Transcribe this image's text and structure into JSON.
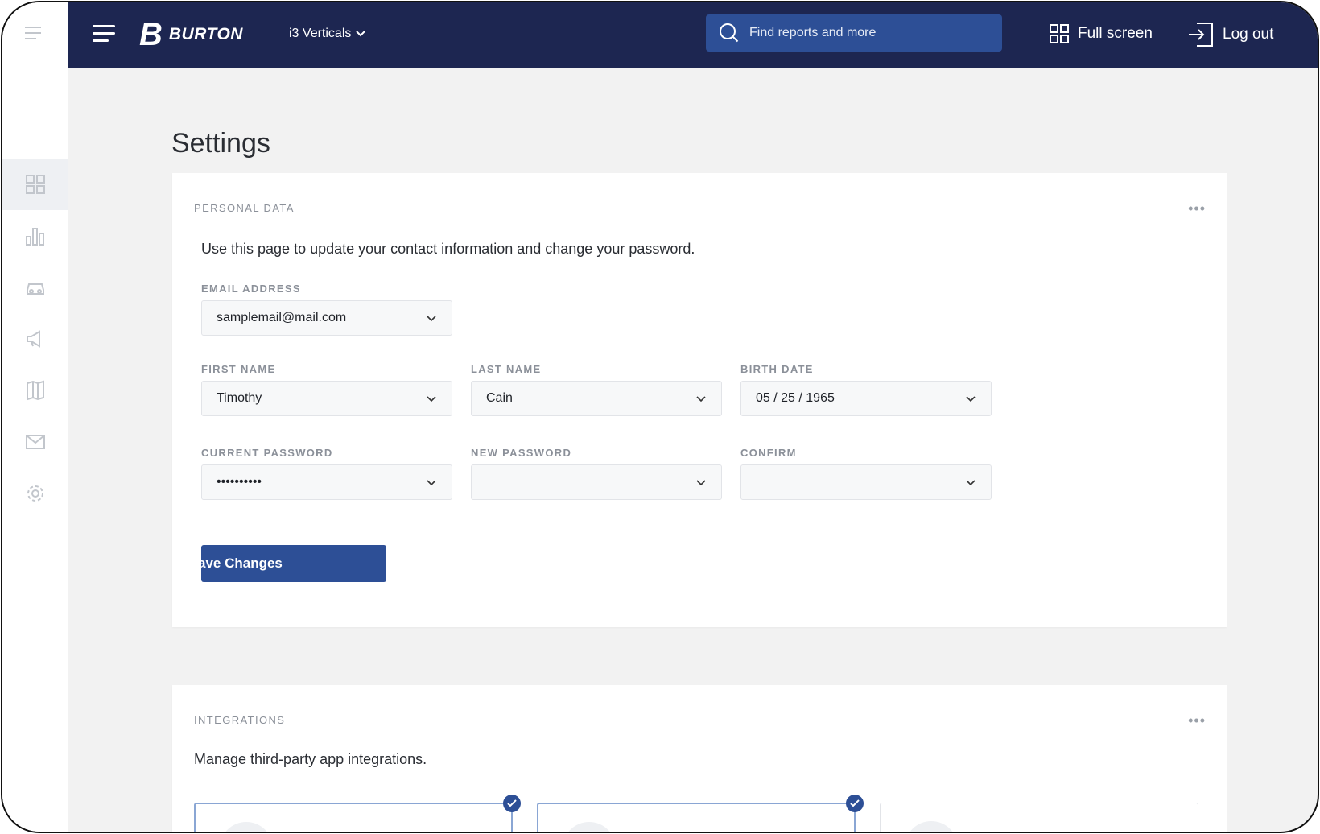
{
  "brand": {
    "name": "BURTON",
    "mark": "B"
  },
  "topbar": {
    "vertical_selector": "i3 Verticals",
    "search_placeholder": "Find reports and more",
    "fullscreen_label": "Full screen",
    "logout_label": "Log out"
  },
  "sidebar": {
    "items": [
      {
        "icon": "dashboard-grid-icon",
        "active": true
      },
      {
        "icon": "bar-chart-icon",
        "active": false
      },
      {
        "icon": "car-icon",
        "active": false
      },
      {
        "icon": "megaphone-icon",
        "active": false
      },
      {
        "icon": "map-icon",
        "active": false
      },
      {
        "icon": "mail-icon",
        "active": false
      },
      {
        "icon": "gear-icon",
        "active": false
      }
    ]
  },
  "page": {
    "title": "Settings"
  },
  "personal": {
    "section_label": "PERSONAL DATA",
    "intro": "Use this page to update your contact information and change your password.",
    "email_label": "EMAIL ADDRESS",
    "email_value": "samplemail@mail.com",
    "first_name_label": "FIRST NAME",
    "first_name_value": "Timothy",
    "last_name_label": "LAST NAME",
    "last_name_value": "Cain",
    "birth_date_label": "BIRTH DATE",
    "birth_date_value": "05 / 25 / 1965",
    "current_password_label": "CURRENT PASSWORD",
    "current_password_value": "••••••••••",
    "new_password_label": "NEW PASSWORD",
    "new_password_value": "",
    "confirm_label": "CONFIRM",
    "confirm_value": "",
    "save_label": "ave Changes"
  },
  "integrations": {
    "section_label": "INTEGRATIONS",
    "intro": "Manage third-party app integrations.",
    "cards": [
      {
        "selected": true
      },
      {
        "selected": true
      },
      {
        "selected": false
      }
    ]
  },
  "colors": {
    "topbar": "#1d2651",
    "accent": "#2d4f96",
    "background": "#f2f2f2"
  }
}
